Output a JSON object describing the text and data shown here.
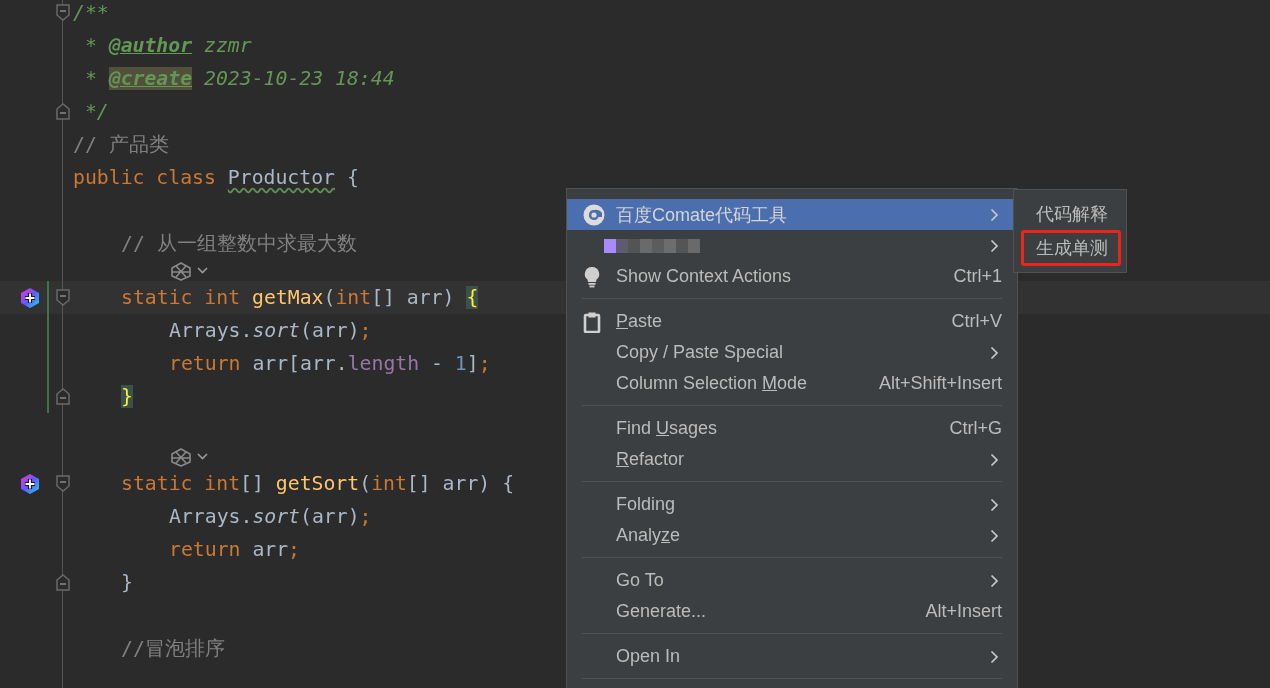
{
  "editor": {
    "lines": [
      {
        "kind": "code",
        "fold_start": true,
        "tokens": [
          {
            "text": "/**",
            "kind": "doc"
          }
        ]
      },
      {
        "kind": "code",
        "tokens": [
          {
            "text": " * ",
            "kind": "doc"
          },
          {
            "text": "@author",
            "kind": "doc-tag"
          },
          {
            "text": " zzmr",
            "kind": "doc"
          }
        ]
      },
      {
        "kind": "code",
        "tokens": [
          {
            "text": " * ",
            "kind": "doc"
          },
          {
            "text": "@create",
            "kind": "doc-tag-match"
          },
          {
            "text": " 2023-10-23 18:44",
            "kind": "doc"
          }
        ]
      },
      {
        "kind": "code",
        "fold_end": true,
        "tokens": [
          {
            "text": " */",
            "kind": "doc"
          }
        ]
      },
      {
        "kind": "code",
        "tokens": [
          {
            "text": "// 产品类",
            "kind": "comment"
          }
        ]
      },
      {
        "kind": "code",
        "tokens": [
          {
            "text": "public class ",
            "kind": "keyword"
          },
          {
            "text": "Productor",
            "kind": "typo"
          },
          {
            "text": " {",
            "kind": "plain"
          }
        ],
        "children": [
          {
            "kind": "blank"
          },
          {
            "kind": "code",
            "tokens": [
              {
                "text": "// 从一组整数中求最大数",
                "kind": "comment"
              }
            ]
          },
          {
            "kind": "hint"
          },
          {
            "kind": "code",
            "current": true,
            "comate": true,
            "fold_start": true,
            "modified": true,
            "tokens": [
              {
                "text": "static int ",
                "kind": "keyword"
              },
              {
                "text": "getMax",
                "kind": "method"
              },
              {
                "text": "(",
                "kind": "plain"
              },
              {
                "text": "int",
                "kind": "keyword"
              },
              {
                "text": "[] arr) ",
                "kind": "plain"
              },
              {
                "text": "{",
                "kind": "brace-match"
              }
            ],
            "children": [
              {
                "kind": "code",
                "modified": true,
                "tokens": [
                  {
                    "text": "Arrays.",
                    "kind": "plain"
                  },
                  {
                    "text": "sort",
                    "kind": "static-call"
                  },
                  {
                    "text": "(arr)",
                    "kind": "plain"
                  },
                  {
                    "text": ";",
                    "kind": "keyword"
                  }
                ]
              },
              {
                "kind": "code",
                "modified": true,
                "tokens": [
                  {
                    "text": "return ",
                    "kind": "keyword"
                  },
                  {
                    "text": "arr[arr.",
                    "kind": "plain"
                  },
                  {
                    "text": "length",
                    "kind": "field"
                  },
                  {
                    "text": " - ",
                    "kind": "plain"
                  },
                  {
                    "text": "1",
                    "kind": "number"
                  },
                  {
                    "text": "]",
                    "kind": "plain"
                  },
                  {
                    "text": ";",
                    "kind": "keyword"
                  }
                ]
              }
            ]
          },
          {
            "kind": "code",
            "fold_end": true,
            "modified": true,
            "tokens": [
              {
                "text": "}",
                "kind": "brace-match"
              }
            ]
          },
          {
            "kind": "blank"
          },
          {
            "kind": "hint"
          },
          {
            "kind": "code",
            "comate": true,
            "fold_start": true,
            "tokens": [
              {
                "text": "static int",
                "kind": "keyword"
              },
              {
                "text": "[] ",
                "kind": "plain"
              },
              {
                "text": "getSort",
                "kind": "method"
              },
              {
                "text": "(",
                "kind": "plain"
              },
              {
                "text": "int",
                "kind": "keyword"
              },
              {
                "text": "[] arr) {",
                "kind": "plain"
              }
            ],
            "children": [
              {
                "kind": "code",
                "tokens": [
                  {
                    "text": "Arrays.",
                    "kind": "plain"
                  },
                  {
                    "text": "sort",
                    "kind": "static-call"
                  },
                  {
                    "text": "(arr)",
                    "kind": "plain"
                  },
                  {
                    "text": ";",
                    "kind": "keyword"
                  }
                ]
              },
              {
                "kind": "code",
                "tokens": [
                  {
                    "text": "return ",
                    "kind": "keyword"
                  },
                  {
                    "text": "arr",
                    "kind": "plain"
                  },
                  {
                    "text": ";",
                    "kind": "keyword"
                  }
                ]
              }
            ]
          },
          {
            "kind": "code",
            "fold_end": true,
            "tokens": [
              {
                "text": "}",
                "kind": "plain"
              }
            ]
          },
          {
            "kind": "blank"
          },
          {
            "kind": "code",
            "tokens": [
              {
                "text": "//冒泡排序",
                "kind": "comment"
              }
            ]
          },
          {
            "kind": "blank"
          }
        ]
      }
    ]
  },
  "context_menu": {
    "items": [
      {
        "kind": "logo",
        "label": "百度Comate代码工具",
        "submenu": true,
        "selected": true
      },
      {
        "kind": "blurred",
        "submenu": true,
        "selected": false
      },
      {
        "kind": "bulb",
        "label": "Show Context Actions",
        "shortcut": "Ctrl+1",
        "selected": false
      },
      {
        "kind": "separator"
      },
      {
        "kind": "clipboard",
        "mnemonic": "P",
        "label_after": "aste",
        "shortcut": "Ctrl+V",
        "selected": false
      },
      {
        "kind": "item",
        "label": "Copy / Paste Special",
        "submenu": true,
        "selected": false
      },
      {
        "kind": "item",
        "label_before": "Column Selection ",
        "mnemonic": "M",
        "label_after": "ode",
        "shortcut": "Alt+Shift+Insert",
        "selected": false
      },
      {
        "kind": "separator"
      },
      {
        "kind": "item",
        "label_before": "Find ",
        "mnemonic": "U",
        "label_after": "sages",
        "shortcut": "Ctrl+G",
        "selected": false
      },
      {
        "kind": "item",
        "mnemonic": "R",
        "label_after": "efactor",
        "submenu": true,
        "selected": false
      },
      {
        "kind": "separator"
      },
      {
        "kind": "item",
        "label": "Folding",
        "submenu": true,
        "selected": false
      },
      {
        "kind": "item",
        "label_before": "Analy",
        "mnemonic": "z",
        "label_after": "e",
        "submenu": true,
        "selected": false
      },
      {
        "kind": "separator"
      },
      {
        "kind": "item",
        "label": "Go To",
        "submenu": true,
        "selected": false
      },
      {
        "kind": "item",
        "label": "Generate...",
        "shortcut": "Alt+Insert",
        "selected": false
      },
      {
        "kind": "separator"
      },
      {
        "kind": "item",
        "label": "Open In",
        "submenu": true,
        "selected": false
      },
      {
        "kind": "separator"
      }
    ]
  },
  "submenu": {
    "items": [
      {
        "label": "代码解释",
        "annotated": false
      },
      {
        "label": "生成单测",
        "annotated": true
      }
    ]
  }
}
